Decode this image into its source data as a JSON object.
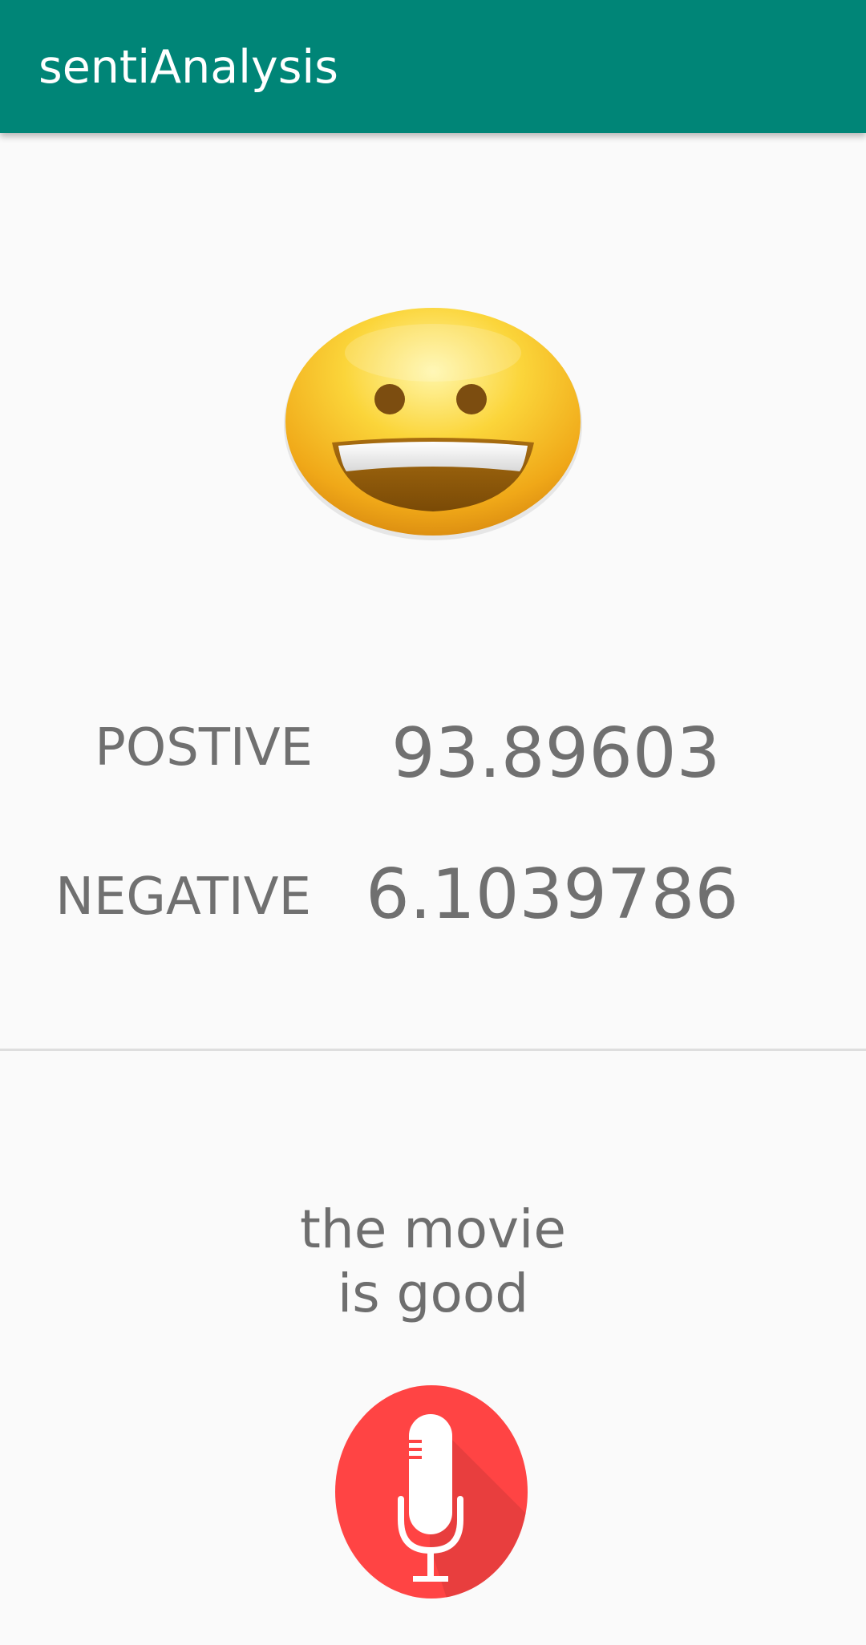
{
  "app": {
    "title": "sentiAnalysis",
    "primary_color": "#008577"
  },
  "result": {
    "emoji_icon": "grinning-face-icon",
    "positive_label": "POSTIVE",
    "positive_value": "93.89603",
    "negative_label": "NEGATIVE",
    "negative_value": "6.1039786",
    "text_color": "#707070"
  },
  "speech": {
    "text_line1": "the movie",
    "text_line2": "is good"
  },
  "mic": {
    "icon": "microphone-icon",
    "color": "#ff4444"
  }
}
